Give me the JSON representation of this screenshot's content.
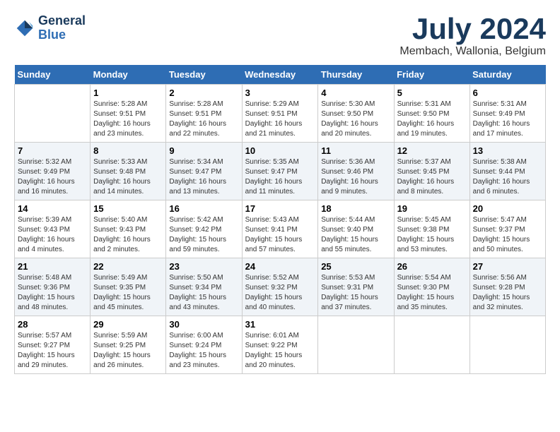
{
  "header": {
    "logo_line1": "General",
    "logo_line2": "Blue",
    "month_year": "July 2024",
    "location": "Membach, Wallonia, Belgium"
  },
  "days_of_week": [
    "Sunday",
    "Monday",
    "Tuesday",
    "Wednesday",
    "Thursday",
    "Friday",
    "Saturday"
  ],
  "weeks": [
    [
      {
        "day": "",
        "info": ""
      },
      {
        "day": "1",
        "info": "Sunrise: 5:28 AM\nSunset: 9:51 PM\nDaylight: 16 hours\nand 23 minutes."
      },
      {
        "day": "2",
        "info": "Sunrise: 5:28 AM\nSunset: 9:51 PM\nDaylight: 16 hours\nand 22 minutes."
      },
      {
        "day": "3",
        "info": "Sunrise: 5:29 AM\nSunset: 9:51 PM\nDaylight: 16 hours\nand 21 minutes."
      },
      {
        "day": "4",
        "info": "Sunrise: 5:30 AM\nSunset: 9:50 PM\nDaylight: 16 hours\nand 20 minutes."
      },
      {
        "day": "5",
        "info": "Sunrise: 5:31 AM\nSunset: 9:50 PM\nDaylight: 16 hours\nand 19 minutes."
      },
      {
        "day": "6",
        "info": "Sunrise: 5:31 AM\nSunset: 9:49 PM\nDaylight: 16 hours\nand 17 minutes."
      }
    ],
    [
      {
        "day": "7",
        "info": "Sunrise: 5:32 AM\nSunset: 9:49 PM\nDaylight: 16 hours\nand 16 minutes."
      },
      {
        "day": "8",
        "info": "Sunrise: 5:33 AM\nSunset: 9:48 PM\nDaylight: 16 hours\nand 14 minutes."
      },
      {
        "day": "9",
        "info": "Sunrise: 5:34 AM\nSunset: 9:47 PM\nDaylight: 16 hours\nand 13 minutes."
      },
      {
        "day": "10",
        "info": "Sunrise: 5:35 AM\nSunset: 9:47 PM\nDaylight: 16 hours\nand 11 minutes."
      },
      {
        "day": "11",
        "info": "Sunrise: 5:36 AM\nSunset: 9:46 PM\nDaylight: 16 hours\nand 9 minutes."
      },
      {
        "day": "12",
        "info": "Sunrise: 5:37 AM\nSunset: 9:45 PM\nDaylight: 16 hours\nand 8 minutes."
      },
      {
        "day": "13",
        "info": "Sunrise: 5:38 AM\nSunset: 9:44 PM\nDaylight: 16 hours\nand 6 minutes."
      }
    ],
    [
      {
        "day": "14",
        "info": "Sunrise: 5:39 AM\nSunset: 9:43 PM\nDaylight: 16 hours\nand 4 minutes."
      },
      {
        "day": "15",
        "info": "Sunrise: 5:40 AM\nSunset: 9:43 PM\nDaylight: 16 hours\nand 2 minutes."
      },
      {
        "day": "16",
        "info": "Sunrise: 5:42 AM\nSunset: 9:42 PM\nDaylight: 15 hours\nand 59 minutes."
      },
      {
        "day": "17",
        "info": "Sunrise: 5:43 AM\nSunset: 9:41 PM\nDaylight: 15 hours\nand 57 minutes."
      },
      {
        "day": "18",
        "info": "Sunrise: 5:44 AM\nSunset: 9:40 PM\nDaylight: 15 hours\nand 55 minutes."
      },
      {
        "day": "19",
        "info": "Sunrise: 5:45 AM\nSunset: 9:38 PM\nDaylight: 15 hours\nand 53 minutes."
      },
      {
        "day": "20",
        "info": "Sunrise: 5:47 AM\nSunset: 9:37 PM\nDaylight: 15 hours\nand 50 minutes."
      }
    ],
    [
      {
        "day": "21",
        "info": "Sunrise: 5:48 AM\nSunset: 9:36 PM\nDaylight: 15 hours\nand 48 minutes."
      },
      {
        "day": "22",
        "info": "Sunrise: 5:49 AM\nSunset: 9:35 PM\nDaylight: 15 hours\nand 45 minutes."
      },
      {
        "day": "23",
        "info": "Sunrise: 5:50 AM\nSunset: 9:34 PM\nDaylight: 15 hours\nand 43 minutes."
      },
      {
        "day": "24",
        "info": "Sunrise: 5:52 AM\nSunset: 9:32 PM\nDaylight: 15 hours\nand 40 minutes."
      },
      {
        "day": "25",
        "info": "Sunrise: 5:53 AM\nSunset: 9:31 PM\nDaylight: 15 hours\nand 37 minutes."
      },
      {
        "day": "26",
        "info": "Sunrise: 5:54 AM\nSunset: 9:30 PM\nDaylight: 15 hours\nand 35 minutes."
      },
      {
        "day": "27",
        "info": "Sunrise: 5:56 AM\nSunset: 9:28 PM\nDaylight: 15 hours\nand 32 minutes."
      }
    ],
    [
      {
        "day": "28",
        "info": "Sunrise: 5:57 AM\nSunset: 9:27 PM\nDaylight: 15 hours\nand 29 minutes."
      },
      {
        "day": "29",
        "info": "Sunrise: 5:59 AM\nSunset: 9:25 PM\nDaylight: 15 hours\nand 26 minutes."
      },
      {
        "day": "30",
        "info": "Sunrise: 6:00 AM\nSunset: 9:24 PM\nDaylight: 15 hours\nand 23 minutes."
      },
      {
        "day": "31",
        "info": "Sunrise: 6:01 AM\nSunset: 9:22 PM\nDaylight: 15 hours\nand 20 minutes."
      },
      {
        "day": "",
        "info": ""
      },
      {
        "day": "",
        "info": ""
      },
      {
        "day": "",
        "info": ""
      }
    ]
  ]
}
